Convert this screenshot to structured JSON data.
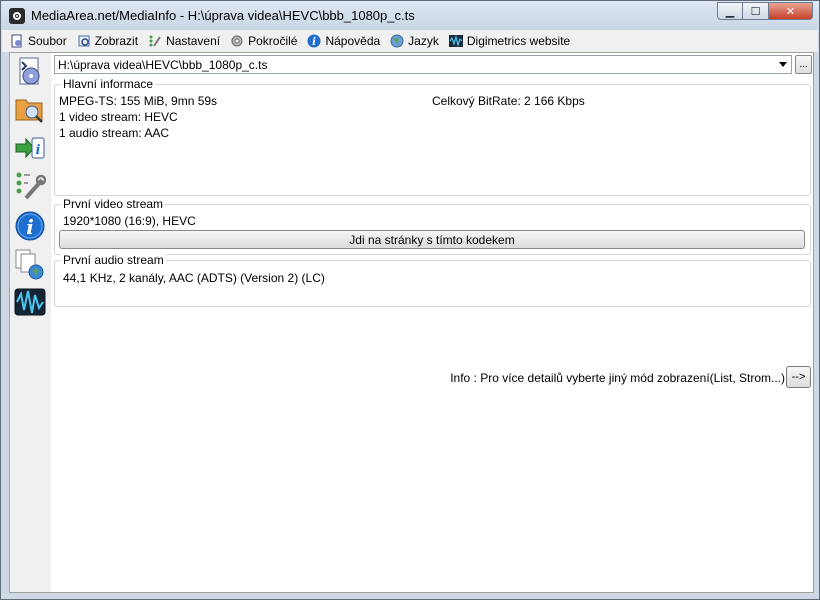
{
  "window": {
    "title": "MediaArea.net/MediaInfo - H:\\úprava videa\\HEVC\\bbb_1080p_c.ts"
  },
  "menu": {
    "items": [
      {
        "label": "Soubor",
        "icon": "file-icon"
      },
      {
        "label": "Zobrazit",
        "icon": "view-icon"
      },
      {
        "label": "Nastavení",
        "icon": "settings-icon"
      },
      {
        "label": "Pokročilé",
        "icon": "gear-icon"
      },
      {
        "label": "Nápověda",
        "icon": "info-icon"
      },
      {
        "label": "Jazyk",
        "icon": "globe-icon"
      },
      {
        "label": "Digimetrics website",
        "icon": "waveform-icon"
      }
    ]
  },
  "sidebar": {
    "items": [
      {
        "icon": "open-file-icon"
      },
      {
        "icon": "open-folder-icon"
      },
      {
        "icon": "export-icon"
      },
      {
        "icon": "preferences-icon"
      },
      {
        "icon": "about-icon"
      },
      {
        "icon": "web-icon"
      },
      {
        "icon": "digimetrics-icon"
      }
    ]
  },
  "file": {
    "path": "H:\\úprava videa\\HEVC\\bbb_1080p_c.ts",
    "browse_label": "..."
  },
  "general": {
    "label": "Hlavní informace",
    "format_line": "MPEG-TS: 155 MiB, 9mn 59s",
    "bitrate_line": "Celkový BitRate: 2 166 Kbps",
    "video_count": "1 video stream: HEVC",
    "audio_count": "1 audio stream: AAC"
  },
  "video": {
    "label": "První video stream",
    "details": "1920*1080 (16:9), HEVC",
    "codec_button": "Jdi na stránky s tímto kodekem"
  },
  "audio": {
    "label": "První audio stream",
    "details": "44,1 KHz, 2 kanály, AAC (ADTS) (Version 2) (LC)"
  },
  "footer": {
    "info": "Info : Pro více detailů vyberte jiný mód zobrazení(List, Strom...)",
    "more_label": "-->"
  },
  "colors": {
    "titlebar": "#cfd9e6",
    "close_button": "#c7402a",
    "sidebar_bg": "#f0f0f0",
    "info_blue": "#1f6fd1"
  }
}
